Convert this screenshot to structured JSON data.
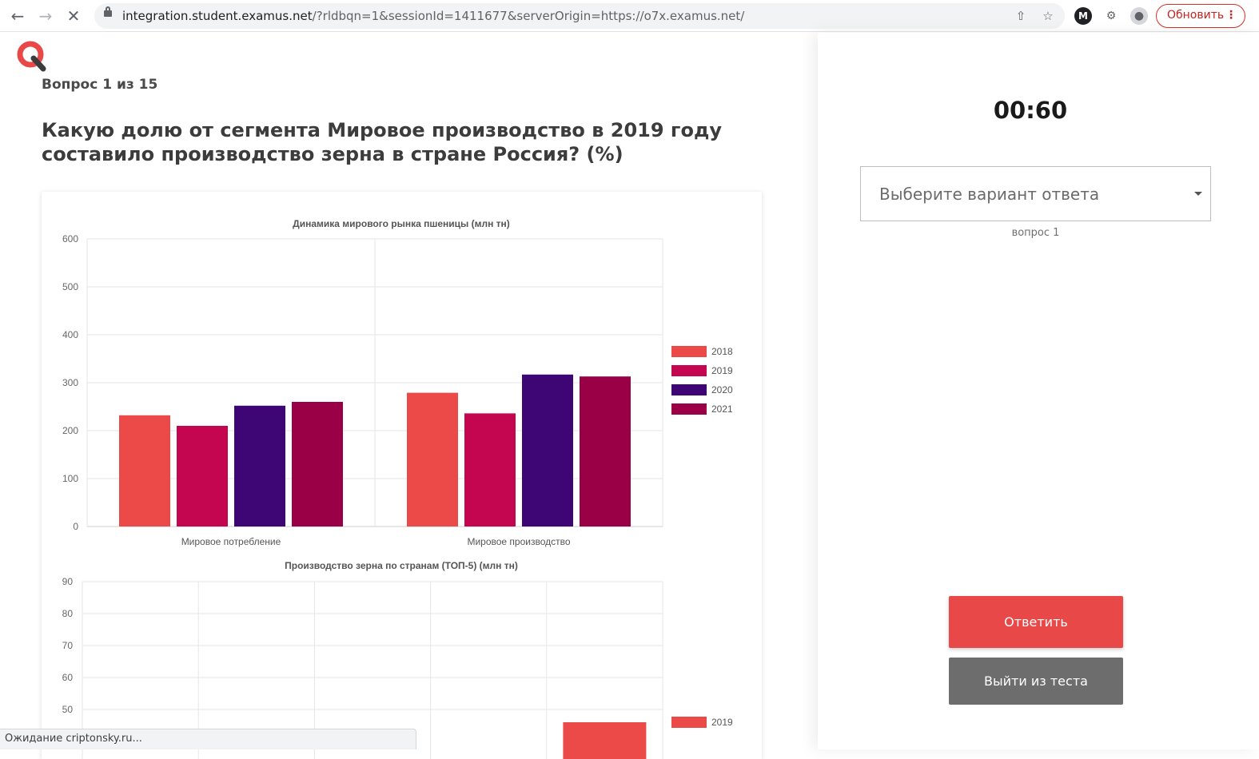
{
  "browser": {
    "url_host": "integration.student.examus.net",
    "url_path": "/?rldbqn=1&sessionId=1411677&serverOrigin=https://o7x.examus.net/",
    "update_label": "Обновить",
    "status_text": "Ожидание criptonsky.ru..."
  },
  "quiz": {
    "counter": "Вопрос 1 из 15",
    "question": "Какую долю от сегмента Мировое производство в 2019 году составило производство зерна в стране Россия? (%)",
    "timer": "00:60",
    "select_placeholder": "Выберите вариант ответа",
    "select_caption": "вопрос 1",
    "answer_label": "Ответить",
    "exit_label": "Выйти из теста",
    "accent": "#e84848"
  },
  "chart_data": [
    {
      "type": "bar",
      "title": "Динамика мирового рынка пшеницы (млн тн)",
      "categories": [
        "Мировое потребление",
        "Мировое производство"
      ],
      "ylim": [
        0,
        600
      ],
      "yticks": [
        0,
        100,
        200,
        300,
        400,
        500,
        600
      ],
      "grid": true,
      "legend": "right",
      "series": [
        {
          "name": "2018",
          "color": "#ec4949",
          "values": [
            232,
            279
          ]
        },
        {
          "name": "2019",
          "color": "#c4054f",
          "values": [
            210,
            236
          ]
        },
        {
          "name": "2020",
          "color": "#3e0574",
          "values": [
            252,
            317
          ]
        },
        {
          "name": "2021",
          "color": "#9a0046",
          "values": [
            260,
            313
          ]
        }
      ]
    },
    {
      "type": "bar",
      "title": "Производство зерна по странам (ТОП-5) (млн тн)",
      "categories": [
        "",
        "",
        "",
        "",
        ""
      ],
      "yticks_visible": [
        50,
        60,
        70,
        80,
        90
      ],
      "ylim": [
        0,
        90
      ],
      "grid": true,
      "legend": "right",
      "series": [
        {
          "name": "2019",
          "color": "#ec4949",
          "values": [
            null,
            null,
            null,
            null,
            46
          ]
        }
      ]
    }
  ]
}
